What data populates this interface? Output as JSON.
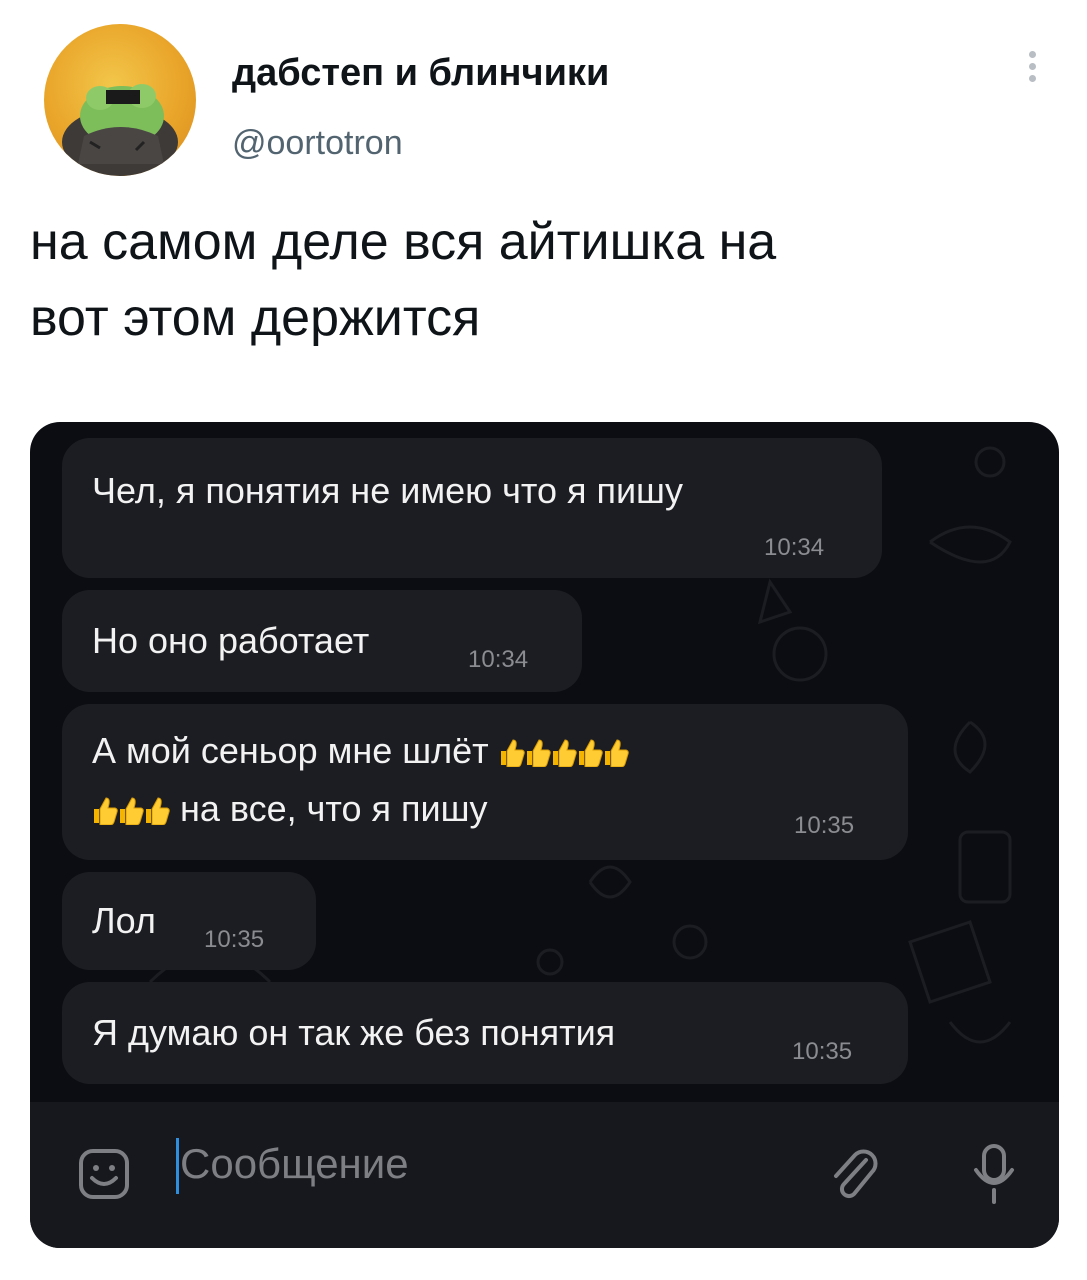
{
  "tweet": {
    "author_name": "дабстеп и блинчики",
    "author_handle": "@oortotron",
    "text": "на самом деле вся айтишка на вот этом держится",
    "text_lines": [
      "на самом деле вся айтишка на",
      "вот этом держится"
    ]
  },
  "chat": {
    "messages": [
      {
        "text": "Чел, я понятия не имею что я пишу",
        "time": "10:34"
      },
      {
        "text": "Но оно работает",
        "time": "10:34"
      },
      {
        "text_before": "А мой сеньор мне шлёт",
        "thumbs_line1": 5,
        "thumbs_line2": 3,
        "text_after": "на все, что я пишу",
        "time": "10:35"
      },
      {
        "text": "Лол",
        "time": "10:35"
      },
      {
        "text": "Я думаю он так же без понятия",
        "time": "10:35"
      }
    ],
    "input_placeholder": "Сообщение"
  },
  "colors": {
    "chat_bg": "#0c0d12",
    "bubble": "#1c1d22",
    "cursor": "#2f8fdd",
    "handle": "#536471"
  },
  "icons": [
    "more-icon",
    "sticker-icon",
    "attach-icon",
    "microphone-icon",
    "thumbs-up-emoji"
  ]
}
